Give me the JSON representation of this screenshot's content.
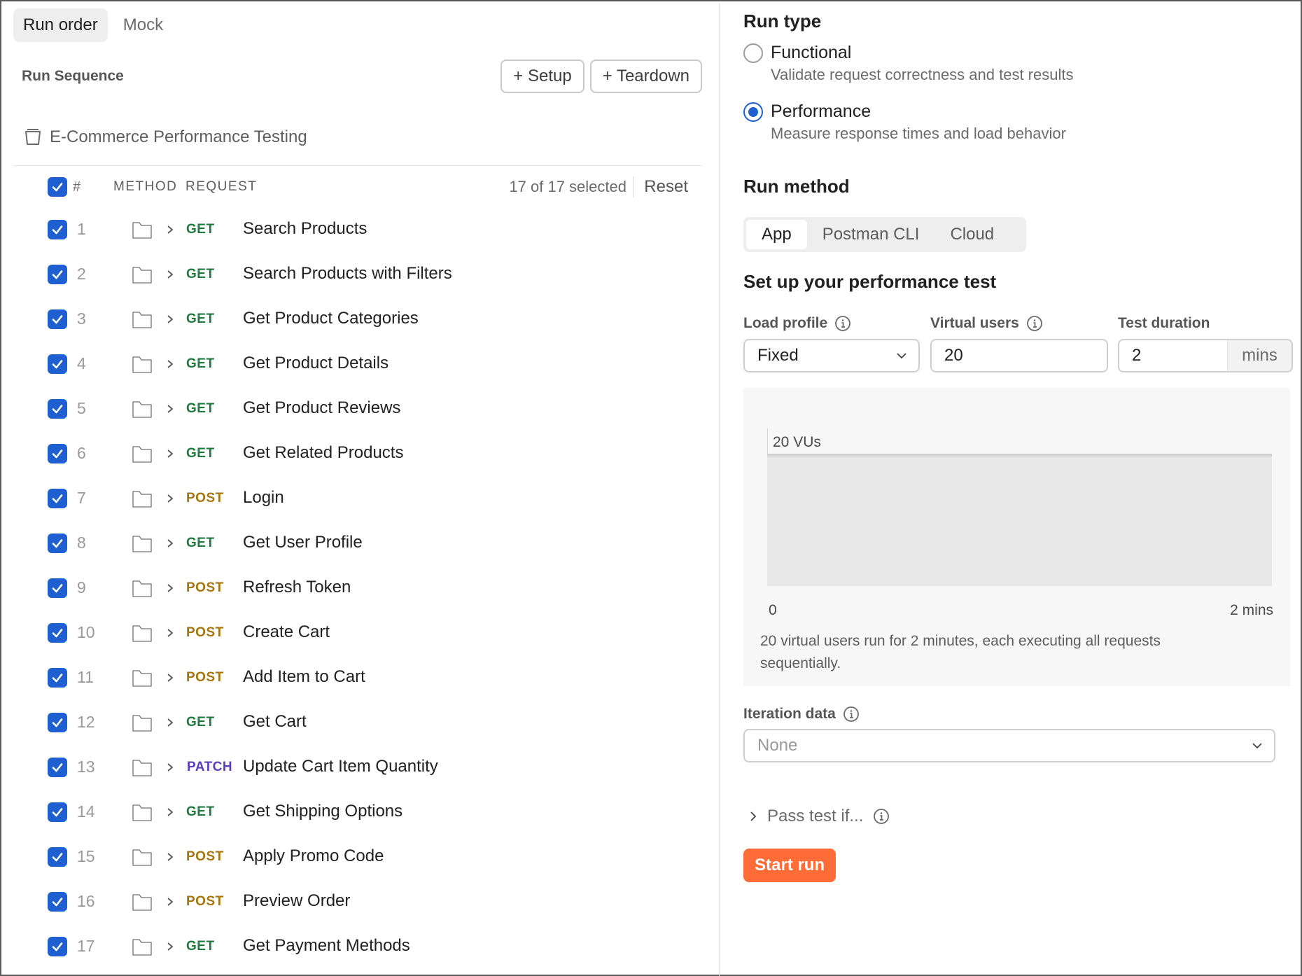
{
  "tabs": [
    {
      "label": "Run order",
      "active": true
    },
    {
      "label": "Mock",
      "active": false
    }
  ],
  "sequence": {
    "title": "Run Sequence",
    "setup_label": "+ Setup",
    "teardown_label": "+ Teardown",
    "collection_name": "E-Commerce Performance Testing"
  },
  "table": {
    "hash_header": "#",
    "method_header": "METHOD",
    "request_header": "REQUEST",
    "selected_text": "17 of 17 selected",
    "reset_label": "Reset"
  },
  "colors": {
    "accent": "#1f5fd1",
    "get": "#1f7a3d",
    "post": "#a6750d",
    "patch": "#5b3fbf",
    "start": "#ff6c37"
  },
  "requests": [
    {
      "num": "1",
      "method": "GET",
      "name": "Search Products",
      "checked": true
    },
    {
      "num": "2",
      "method": "GET",
      "name": "Search Products with Filters",
      "checked": true
    },
    {
      "num": "3",
      "method": "GET",
      "name": "Get Product Categories",
      "checked": true
    },
    {
      "num": "4",
      "method": "GET",
      "name": "Get Product Details",
      "checked": true
    },
    {
      "num": "5",
      "method": "GET",
      "name": "Get Product Reviews",
      "checked": true
    },
    {
      "num": "6",
      "method": "GET",
      "name": "Get Related Products",
      "checked": true
    },
    {
      "num": "7",
      "method": "POST",
      "name": "Login",
      "checked": true
    },
    {
      "num": "8",
      "method": "GET",
      "name": "Get User Profile",
      "checked": true
    },
    {
      "num": "9",
      "method": "POST",
      "name": "Refresh Token",
      "checked": true
    },
    {
      "num": "10",
      "method": "POST",
      "name": "Create Cart",
      "checked": true
    },
    {
      "num": "11",
      "method": "POST",
      "name": "Add Item to Cart",
      "checked": true
    },
    {
      "num": "12",
      "method": "GET",
      "name": "Get Cart",
      "checked": true
    },
    {
      "num": "13",
      "method": "PATCH",
      "name": "Update Cart Item Quantity",
      "checked": true
    },
    {
      "num": "14",
      "method": "GET",
      "name": "Get Shipping Options",
      "checked": true
    },
    {
      "num": "15",
      "method": "POST",
      "name": "Apply Promo Code",
      "checked": true
    },
    {
      "num": "16",
      "method": "POST",
      "name": "Preview Order",
      "checked": true
    },
    {
      "num": "17",
      "method": "GET",
      "name": "Get Payment Methods",
      "checked": true
    }
  ],
  "run_type": {
    "title": "Run type",
    "options": [
      {
        "label": "Functional",
        "desc": "Validate request correctness and test results",
        "selected": false
      },
      {
        "label": "Performance",
        "desc": "Measure response times and load behavior",
        "selected": true
      }
    ]
  },
  "run_method": {
    "title": "Run method",
    "options": [
      {
        "label": "App",
        "active": true
      },
      {
        "label": "Postman CLI",
        "active": false
      },
      {
        "label": "Cloud",
        "active": false
      }
    ]
  },
  "perf": {
    "title": "Set up your performance test",
    "load_profile_label": "Load profile",
    "load_profile_value": "Fixed",
    "virtual_users_label": "Virtual users",
    "virtual_users_value": "20",
    "duration_label": "Test duration",
    "duration_value": "2",
    "duration_unit": "mins"
  },
  "chart_data": {
    "type": "area",
    "x": [
      0,
      2
    ],
    "values": [
      20,
      20
    ],
    "y_label_text": "20 VUs",
    "x_start_label": "0",
    "x_end_label": "2 mins",
    "caption": "20 virtual users run for 2 minutes, each executing all requests sequentially."
  },
  "iteration": {
    "label": "Iteration data",
    "placeholder": "None"
  },
  "pass_test_label": "Pass test if...",
  "start_label": "Start run"
}
